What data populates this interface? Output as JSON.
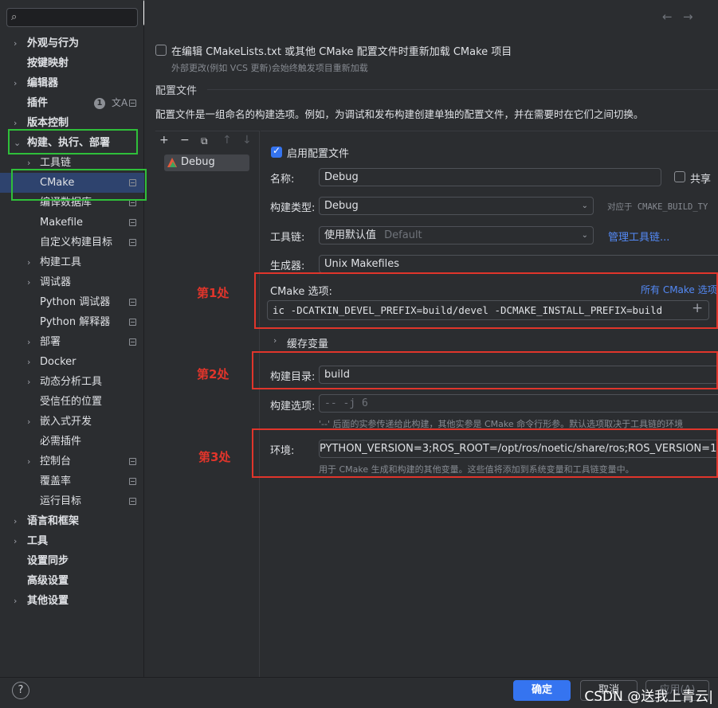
{
  "sidebar": {
    "search_icon": "search-icon",
    "items": [
      {
        "label": "外观与行为",
        "chevron": "›",
        "bold": true
      },
      {
        "label": "按键映射",
        "chevron": "",
        "bold": true
      },
      {
        "label": "编辑器",
        "chevron": "›",
        "bold": true
      },
      {
        "label": "插件",
        "chevron": "",
        "bold": true,
        "badge": "1"
      },
      {
        "label": "版本控制",
        "chevron": "›",
        "bold": true
      },
      {
        "label": "构建、执行、部署",
        "chevron": "⌄",
        "bold": true
      },
      {
        "label": "工具链",
        "chevron": "›"
      },
      {
        "label": "CMake",
        "chevron": "",
        "selected": true
      },
      {
        "label": "编译数据库",
        "chevron": ""
      },
      {
        "label": "Makefile",
        "chevron": ""
      },
      {
        "label": "自定义构建目标",
        "chevron": ""
      },
      {
        "label": "构建工具",
        "chevron": "›"
      },
      {
        "label": "调试器",
        "chevron": "›"
      },
      {
        "label": "Python 调试器",
        "chevron": ""
      },
      {
        "label": "Python 解释器",
        "chevron": ""
      },
      {
        "label": "部署",
        "chevron": "›"
      },
      {
        "label": "Docker",
        "chevron": "›"
      },
      {
        "label": "动态分析工具",
        "chevron": "›"
      },
      {
        "label": "受信任的位置",
        "chevron": ""
      },
      {
        "label": "嵌入式开发",
        "chevron": "›"
      },
      {
        "label": "必需插件",
        "chevron": ""
      },
      {
        "label": "控制台",
        "chevron": "›"
      },
      {
        "label": "覆盖率",
        "chevron": ""
      },
      {
        "label": "运行目标",
        "chevron": ""
      },
      {
        "label": "语言和框架",
        "chevron": "›",
        "bold": true
      },
      {
        "label": "工具",
        "chevron": "›",
        "bold": true
      },
      {
        "label": "设置同步",
        "chevron": "",
        "bold": true
      },
      {
        "label": "高级设置",
        "chevron": "",
        "bold": true
      },
      {
        "label": "其他设置",
        "chevron": "›",
        "bold": true
      }
    ]
  },
  "annotation_toolbar": {
    "colors": [
      "#1aa7f0",
      "#8fd400",
      "#ffbd00",
      "#4d4d4d",
      "#ffffff",
      "#f04e4e"
    ]
  },
  "main": {
    "reload_checkbox_label": "在编辑 CMakeLists.txt 或其他 CMake 配置文件时重新加载 CMake 项目",
    "reload_hint": "外部更改(例如 VCS 更新)会始终触发项目重新加载",
    "section_title": "配置文件",
    "section_desc": "配置文件是一组命名的构建选项。例如，为调试和发布构建创建单独的配置文件，并在需要时在它们之间切换。",
    "nav_back": "←",
    "nav_forward": "→"
  },
  "profiles": {
    "toolbar": [
      "+",
      "−",
      "⧉",
      "↑",
      "↓"
    ],
    "items": [
      "Debug"
    ]
  },
  "details": {
    "enable_label": "启用配置文件",
    "name_label": "名称:",
    "name_value": "Debug",
    "share_label": "共享",
    "build_type_label": "构建类型:",
    "build_type_value": "Debug",
    "build_type_hint": "对应于 CMAKE_BUILD_TY",
    "toolchain_label": "工具链:",
    "toolchain_value": "使用默认值",
    "toolchain_default": "Default",
    "toolchain_link": "管理工具链...",
    "generator_label": "生成器:",
    "generator_value": "Unix Makefiles",
    "cmake_options_label": "CMake 选项:",
    "cmake_options_link": "所有 CMake 选项",
    "cmake_options_value": "ic -DCATKIN_DEVEL_PREFIX=build/devel -DCMAKE_INSTALL_PREFIX=build",
    "cache_label": "缓存变量",
    "build_dir_label": "构建目录:",
    "build_dir_value": "build",
    "build_options_label": "构建选项:",
    "build_options_placeholder": "-- -j 6",
    "build_options_hint": "'--' 后面的实参传递给此构建，其他实参是 CMake 命令行形参。默认选项取决于工具链的环境",
    "env_label": "环境:",
    "env_value": "PYTHON_VERSION=3;ROS_ROOT=/opt/ros/noetic/share/ros;ROS_VERSION=1",
    "env_hint": "用于 CMake 生成和构建的其他变量。这些值将添加到系统变量和工具链变量中。"
  },
  "annotations": {
    "label1": "第1处",
    "label2": "第2处",
    "label3": "第3处"
  },
  "footer": {
    "help": "?",
    "ok": "确定",
    "cancel": "取消",
    "apply": "应用(A)",
    "watermark": "CSDN @送我上青云|"
  }
}
